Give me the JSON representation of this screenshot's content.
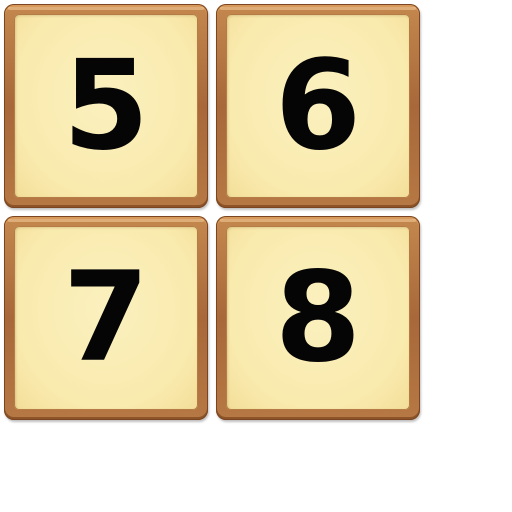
{
  "tiles": [
    {
      "label": "5"
    },
    {
      "label": "6"
    },
    {
      "label": "7"
    },
    {
      "label": "8"
    }
  ],
  "colors": {
    "frame": "#b27340",
    "face": "#f9eaad",
    "digit": "#050505"
  }
}
